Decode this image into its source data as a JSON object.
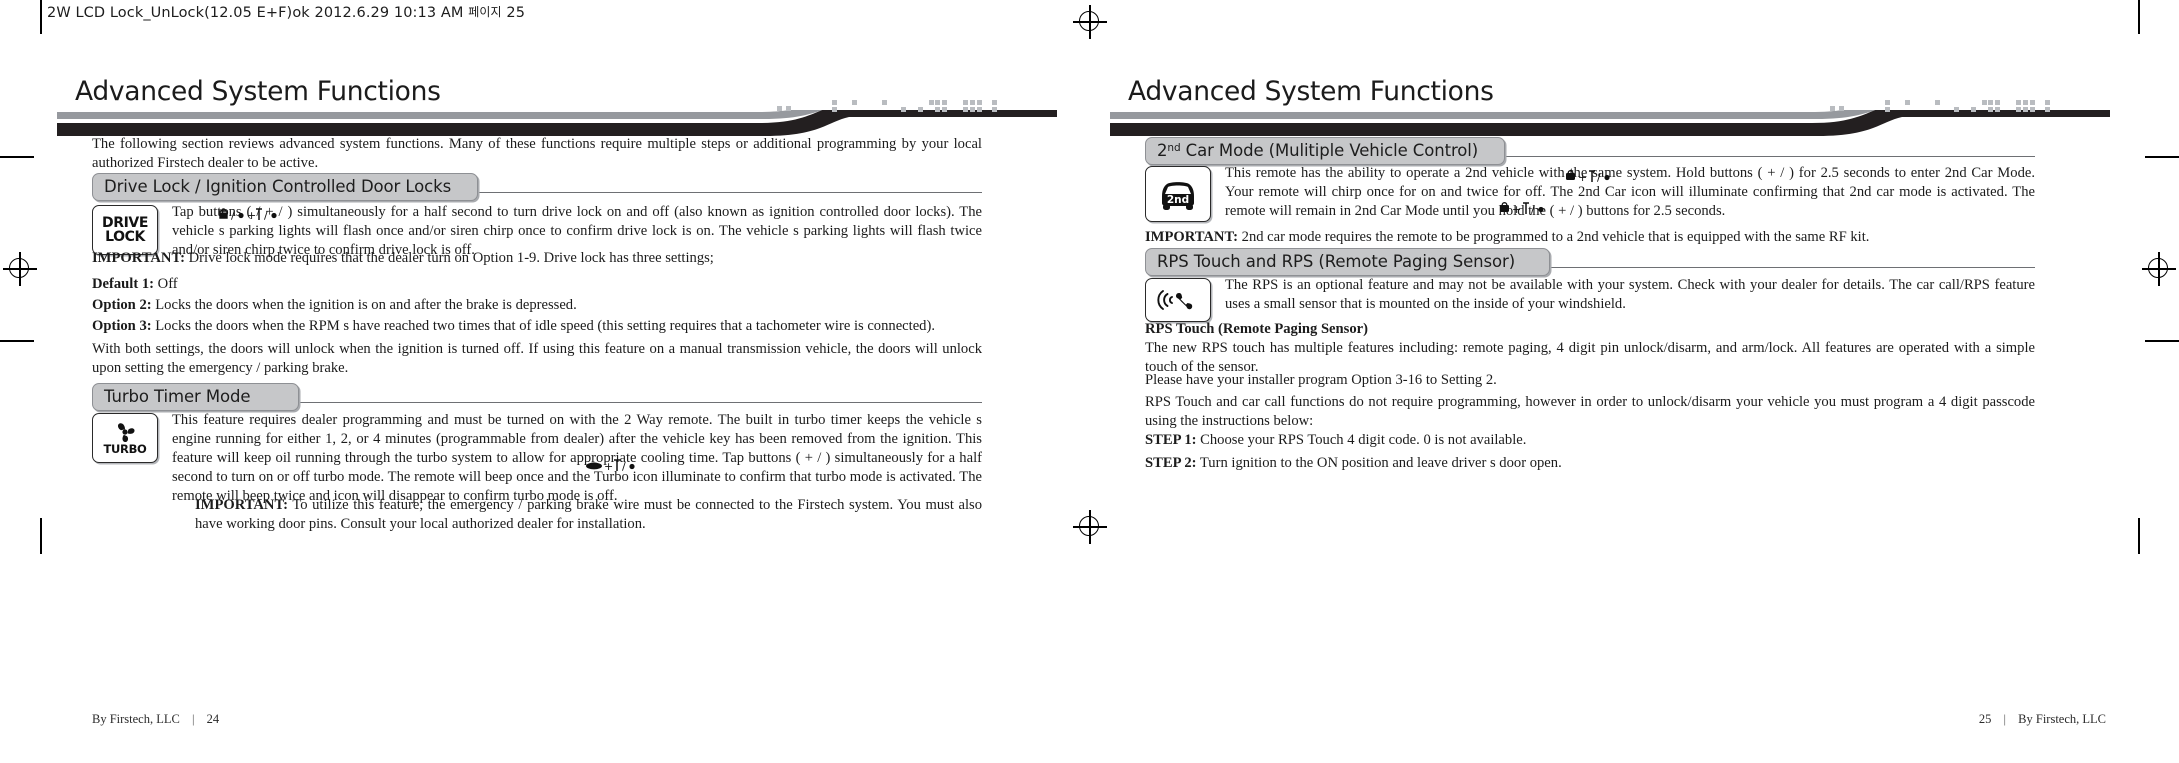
{
  "slug": {
    "text": "2W LCD Lock_UnLock(12.05 E+F)ok   2012.6.29 10:13 AM",
    "korean": "페이지",
    "page_num": "25"
  },
  "left_page": {
    "header_title": "Advanced System Functions",
    "intro": "The following section reviews advanced system functions. Many of these functions require multiple steps or additional programming by your local authorized Firstech dealer to be active.",
    "section1": {
      "heading": "Drive Lock / Ignition Controlled Door Locks",
      "icon_line1": "DRIVE",
      "icon_line2": "LOCK",
      "body": "Tap buttons  (     /     +     /     )  simultaneously for a half second to turn drive lock on and off (also known as ignition controlled door locks). The vehicle s parking lights will flash once and/or siren chirp once to confirm drive lock is on. The vehicle s parking lights will flash twice and/or siren chirp twice to confirm drive lock is off.",
      "important_label": "IMPORTANT:",
      "important_body": "Drive lock mode requires that the dealer turn on Option 1-9. Drive lock has three settings;",
      "options": [
        {
          "label": "Default 1:",
          "text": "Off"
        },
        {
          "label": "Option 2:",
          "text": "Locks the doors when the ignition is on and after the brake is depressed."
        },
        {
          "label": "Option 3:",
          "text": "Locks the doors when the RPM s have reached two times that of idle speed (this setting requires that a tachometer wire is connected)."
        }
      ],
      "closing": "With both settings, the doors will unlock when the ignition is turned off. If using this feature on a manual transmission vehicle, the doors will unlock upon setting the emergency / parking brake."
    },
    "section2": {
      "heading": "Turbo Timer Mode",
      "icon_label": "TURBO",
      "body": "This feature requires dealer programming and must be turned on with the 2 Way remote. The built in turbo timer keeps the vehicle s engine running for either 1, 2, or 4 minutes (programmable from dealer) after the vehicle key has been removed from the ignition. This feature will keep oil running through the turbo system to allow for appropriate cooling time. Tap buttons (       +     /     ) simultaneously for a half second to turn on or off turbo mode. The remote will beep once and the Turbo icon illuminate to confirm that turbo mode is activated. The remote will beep twice and icon will disappear to confirm turbo mode is off.",
      "important_label": "IMPORTANT:",
      "important_body": "To utilize this feature, the emergency / parking brake wire must be connected to the Firstech system. You must also have working door pins. Consult your local authorized dealer for installation."
    },
    "footer": {
      "text": "By Firstech, LLC",
      "sep": "|",
      "page": "24"
    }
  },
  "right_page": {
    "header_title": "Advanced System Functions",
    "section1": {
      "heading_pre": "2",
      "heading_sup": "nd",
      "heading_post": " Car Mode (Mulitiple Vehicle Control)",
      "icon_label": "2nd",
      "body": "This remote has the ability to operate a 2nd vehicle with the same system. Hold buttons (      +     /     ) for 2.5 seconds to enter 2nd Car Mode. Your remote will chirp once for on and twice for off. The 2nd Car icon will illuminate confirming that 2nd car mode is activated. The remote will remain in 2nd Car Mode until you hold the  (      +     /     )  buttons for 2.5 seconds.",
      "important_label": "IMPORTANT:",
      "important_body": "2nd car mode requires the remote to be programmed to a 2nd vehicle that is equipped with the same RF kit."
    },
    "section2": {
      "heading": "RPS Touch and RPS (Remote Paging Sensor)",
      "body": "The RPS is an optional feature and may not be available with your system. Check with your dealer for details. The car call/RPS feature uses a small sensor that is mounted on the inside of your windshield.",
      "sub_heading": "RPS Touch (Remote Paging Sensor)",
      "sub_body": "The new RPS touch has multiple features including: remote paging, 4 digit pin unlock/disarm, and arm/lock. All features are operated with a simple touch of the sensor.",
      "para2": "Please have your installer program Option 3-16 to Setting 2.",
      "para3": "RPS Touch and car call functions do not require programming, however in order to unlock/disarm your vehicle you must program a 4 digit passcode using the instructions below:",
      "steps": [
        {
          "label": "STEP 1:",
          "text": "Choose your RPS Touch 4 digit code.  0  is not available."
        },
        {
          "label": "STEP 2:",
          "text": "Turn ignition to the  ON  position and leave driver s door open."
        }
      ]
    },
    "footer": {
      "page": "25",
      "sep": "|",
      "text": "By Firstech, LLC"
    }
  },
  "colors": {
    "bar_gray": "#96999e",
    "bar_black": "#231f20",
    "pill_fill": "#c6c7c9",
    "dash": "#b9bcc0"
  }
}
